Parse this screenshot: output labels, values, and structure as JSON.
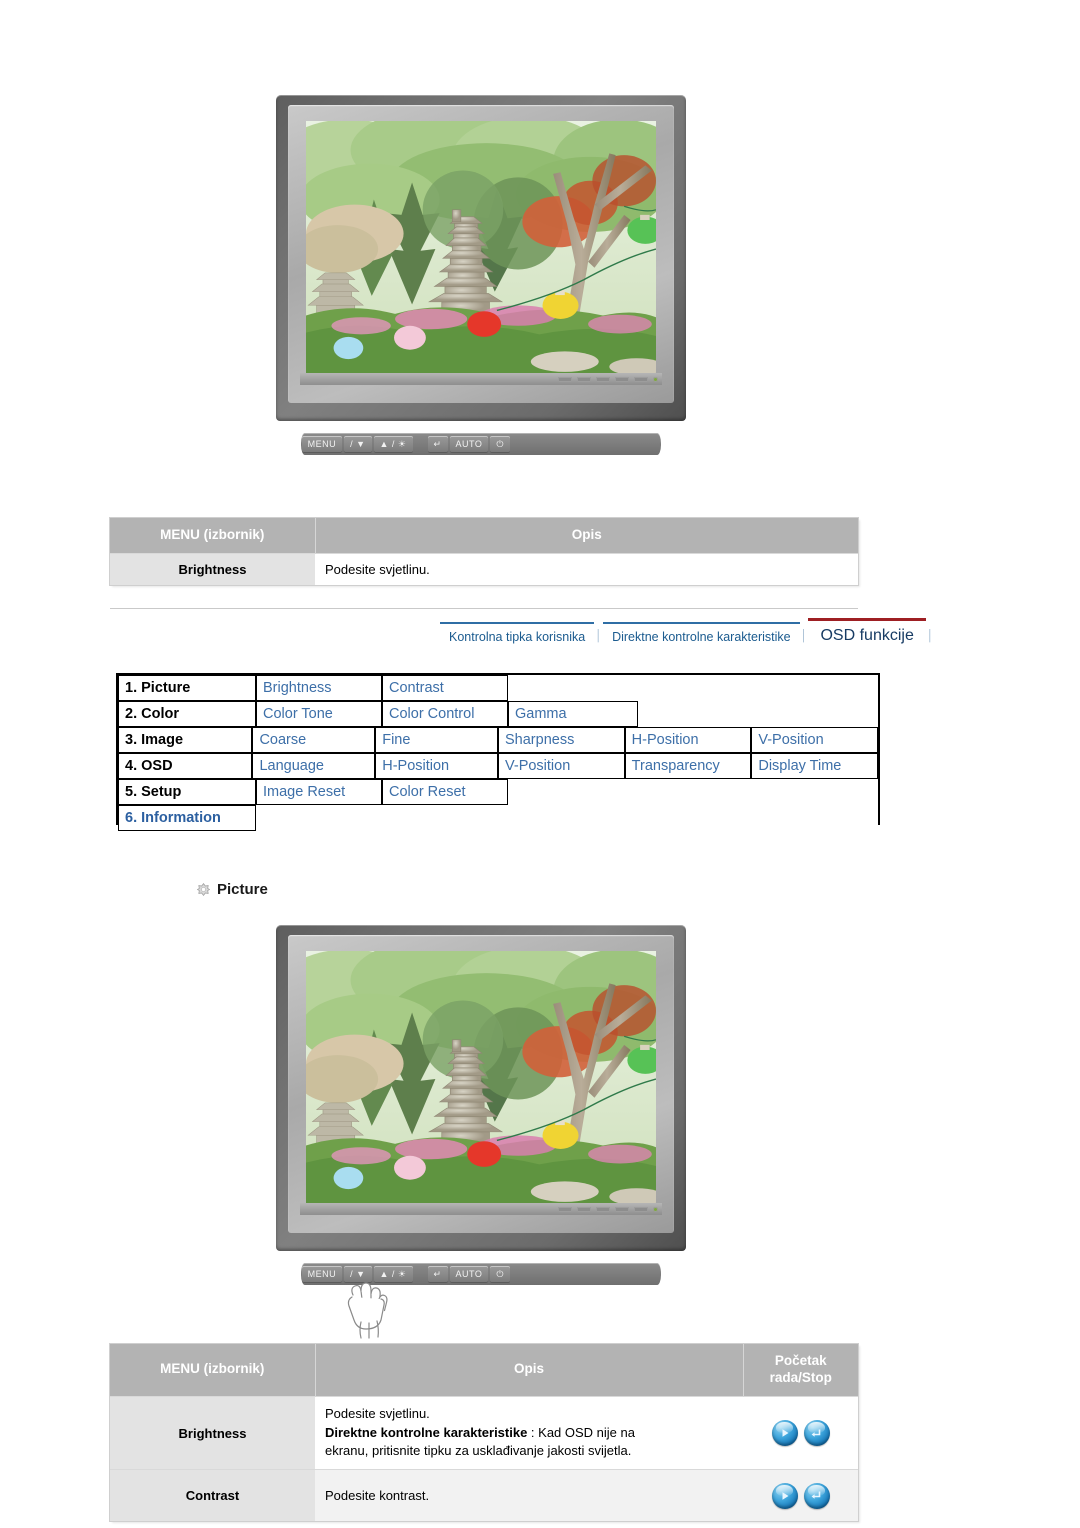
{
  "page": {
    "language": "hr",
    "section_heading": "Picture",
    "section_bullet_icon": "diamond-bullet-icon"
  },
  "monitor_top": {
    "name": "lcd-monitor-illustration",
    "screen_image": "garden-pagoda-lanterns-photo",
    "buttons": [
      {
        "label": "MENU",
        "icon": "menu-button"
      },
      {
        "label": "/ ▼",
        "icon": "source-down-button"
      },
      {
        "label": "▲ / ☀",
        "icon": "up-brightness-button"
      },
      {
        "label": "↵",
        "icon": "enter-button"
      },
      {
        "label": "AUTO",
        "icon": "auto-button"
      },
      {
        "label": "⏻",
        "icon": "power-button"
      }
    ]
  },
  "table_top": {
    "headers": [
      "MENU (izbornik)",
      "Opis"
    ],
    "rows": [
      {
        "menu": "Brightness",
        "opis": "Podesite svjetlinu."
      }
    ]
  },
  "nav": {
    "tabs": [
      {
        "label": "Kontrolna tipka korisnika",
        "active": false
      },
      {
        "label": "Direktne kontrolne karakteristike",
        "active": false
      },
      {
        "label": "OSD funkcije",
        "active": true
      }
    ],
    "separator": "│",
    "accent_active": "#9e1f23",
    "accent_inactive": "#2f6ea5",
    "link_color": "#1b5b8f"
  },
  "osd_menu": {
    "rows": [
      {
        "head": "1. Picture",
        "head_style": "normal",
        "items": [
          "Brightness",
          "Contrast"
        ]
      },
      {
        "head": "2. Color",
        "head_style": "normal",
        "items": [
          "Color Tone",
          "Color Control",
          "Gamma"
        ]
      },
      {
        "head": "3. Image",
        "head_style": "normal",
        "items": [
          "Coarse",
          "Fine",
          "Sharpness",
          "H-Position",
          "V-Position"
        ]
      },
      {
        "head": "4. OSD",
        "head_style": "normal",
        "items": [
          "Language",
          "H-Position",
          "V-Position",
          "Transparency",
          "Display Time"
        ]
      },
      {
        "head": "5. Setup",
        "head_style": "normal",
        "items": [
          "Image Reset",
          "Color Reset"
        ]
      },
      {
        "head": "6. Information",
        "head_style": "info",
        "items": []
      }
    ]
  },
  "monitor_bottom": {
    "name": "lcd-monitor-illustration-with-hand",
    "screen_image": "garden-pagoda-lanterns-photo",
    "hand_icon": "pointing-hand-icon",
    "hand_target": "MENU",
    "buttons": [
      {
        "label": "MENU",
        "icon": "menu-button"
      },
      {
        "label": "/ ▼",
        "icon": "source-down-button"
      },
      {
        "label": "▲ / ☀",
        "icon": "up-brightness-button"
      },
      {
        "label": "↵",
        "icon": "enter-button"
      },
      {
        "label": "AUTO",
        "icon": "auto-button"
      },
      {
        "label": "⏻",
        "icon": "power-button"
      }
    ]
  },
  "table_bottom": {
    "headers": [
      "MENU (izbornik)",
      "Opis",
      "Početak rada/Stop"
    ],
    "header_3_line1": "Početak",
    "header_3_line2": "rada/Stop",
    "rows": [
      {
        "menu": "Brightness",
        "line1": "Podesite svjetlinu.",
        "bold": "Direktne kontrolne karakteristike",
        "after_bold": " : Kad OSD nije na",
        "line3": "ekranu, pritisnite tipku za usklađivanje jakosti svijetla.",
        "icons": [
          "play-circle-icon",
          "enter-circle-icon"
        ]
      },
      {
        "menu": "Contrast",
        "line1": "Podesite kontrast.",
        "bold": "",
        "after_bold": "",
        "line3": "",
        "icons": [
          "play-circle-icon",
          "enter-circle-icon"
        ]
      }
    ]
  }
}
